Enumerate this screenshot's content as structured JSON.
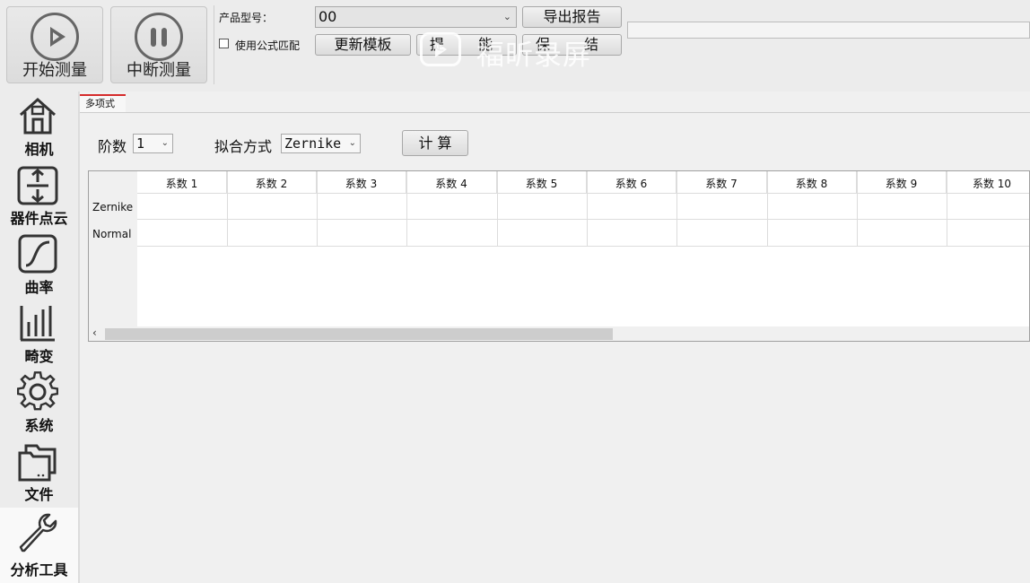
{
  "toolbar": {
    "start_label": "开始测量",
    "stop_label": "中断测量",
    "product_model_label": "产品型号：",
    "product_model_value": "00",
    "export_report_label": "导出报告",
    "use_formula_label": "使用公式匹配",
    "update_template_label": "更新模板",
    "extra_btn1_label": "提",
    "extra_btn1_label_b": "能",
    "extra_btn2_label": "保",
    "extra_btn2_label_b": "结"
  },
  "watermark": {
    "text": "福昕录屏"
  },
  "sidebar": {
    "items": [
      {
        "label": "相机",
        "icon": "house-icon"
      },
      {
        "label": "器件点云",
        "icon": "adjust-icon"
      },
      {
        "label": "曲率",
        "icon": "curve-icon"
      },
      {
        "label": "畸变",
        "icon": "bars-icon"
      },
      {
        "label": "系统",
        "icon": "gear-icon"
      },
      {
        "label": "文件",
        "icon": "folder-icon"
      },
      {
        "label": "分析工具",
        "icon": "wrench-icon"
      }
    ],
    "active_index": 6
  },
  "main": {
    "tab_label": "多项式",
    "order_label": "阶数",
    "order_value": "1",
    "fit_label": "拟合方式",
    "fit_value": "Zernike",
    "calc_label": "计 算",
    "table": {
      "columns": [
        "系数 1",
        "系数 2",
        "系数 3",
        "系数 4",
        "系数 5",
        "系数 6",
        "系数 7",
        "系数 8",
        "系数 9",
        "系数 10"
      ],
      "rows": [
        "Zernike",
        "Normal"
      ]
    }
  },
  "colors": {
    "accent_tab": "#d52b2b",
    "icon_gray": "#666666"
  }
}
